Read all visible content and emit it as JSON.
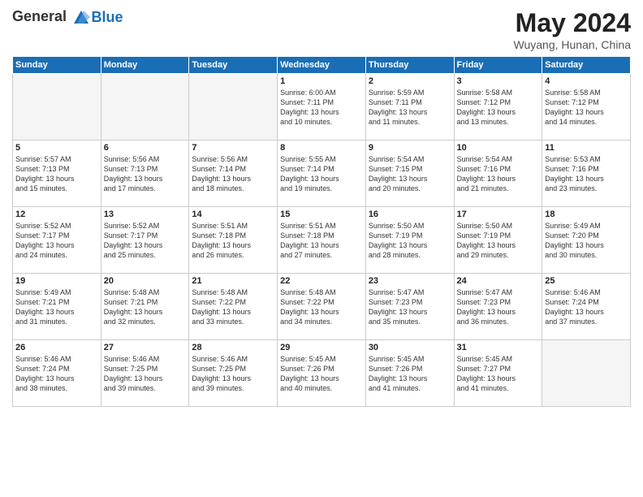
{
  "header": {
    "logo_general": "General",
    "logo_blue": "Blue",
    "month_year": "May 2024",
    "location": "Wuyang, Hunan, China"
  },
  "days_of_week": [
    "Sunday",
    "Monday",
    "Tuesday",
    "Wednesday",
    "Thursday",
    "Friday",
    "Saturday"
  ],
  "weeks": [
    [
      {
        "day": "",
        "info": ""
      },
      {
        "day": "",
        "info": ""
      },
      {
        "day": "",
        "info": ""
      },
      {
        "day": "1",
        "info": "Sunrise: 6:00 AM\nSunset: 7:11 PM\nDaylight: 13 hours\nand 10 minutes."
      },
      {
        "day": "2",
        "info": "Sunrise: 5:59 AM\nSunset: 7:11 PM\nDaylight: 13 hours\nand 11 minutes."
      },
      {
        "day": "3",
        "info": "Sunrise: 5:58 AM\nSunset: 7:12 PM\nDaylight: 13 hours\nand 13 minutes."
      },
      {
        "day": "4",
        "info": "Sunrise: 5:58 AM\nSunset: 7:12 PM\nDaylight: 13 hours\nand 14 minutes."
      }
    ],
    [
      {
        "day": "5",
        "info": "Sunrise: 5:57 AM\nSunset: 7:13 PM\nDaylight: 13 hours\nand 15 minutes."
      },
      {
        "day": "6",
        "info": "Sunrise: 5:56 AM\nSunset: 7:13 PM\nDaylight: 13 hours\nand 17 minutes."
      },
      {
        "day": "7",
        "info": "Sunrise: 5:56 AM\nSunset: 7:14 PM\nDaylight: 13 hours\nand 18 minutes."
      },
      {
        "day": "8",
        "info": "Sunrise: 5:55 AM\nSunset: 7:14 PM\nDaylight: 13 hours\nand 19 minutes."
      },
      {
        "day": "9",
        "info": "Sunrise: 5:54 AM\nSunset: 7:15 PM\nDaylight: 13 hours\nand 20 minutes."
      },
      {
        "day": "10",
        "info": "Sunrise: 5:54 AM\nSunset: 7:16 PM\nDaylight: 13 hours\nand 21 minutes."
      },
      {
        "day": "11",
        "info": "Sunrise: 5:53 AM\nSunset: 7:16 PM\nDaylight: 13 hours\nand 23 minutes."
      }
    ],
    [
      {
        "day": "12",
        "info": "Sunrise: 5:52 AM\nSunset: 7:17 PM\nDaylight: 13 hours\nand 24 minutes."
      },
      {
        "day": "13",
        "info": "Sunrise: 5:52 AM\nSunset: 7:17 PM\nDaylight: 13 hours\nand 25 minutes."
      },
      {
        "day": "14",
        "info": "Sunrise: 5:51 AM\nSunset: 7:18 PM\nDaylight: 13 hours\nand 26 minutes."
      },
      {
        "day": "15",
        "info": "Sunrise: 5:51 AM\nSunset: 7:18 PM\nDaylight: 13 hours\nand 27 minutes."
      },
      {
        "day": "16",
        "info": "Sunrise: 5:50 AM\nSunset: 7:19 PM\nDaylight: 13 hours\nand 28 minutes."
      },
      {
        "day": "17",
        "info": "Sunrise: 5:50 AM\nSunset: 7:19 PM\nDaylight: 13 hours\nand 29 minutes."
      },
      {
        "day": "18",
        "info": "Sunrise: 5:49 AM\nSunset: 7:20 PM\nDaylight: 13 hours\nand 30 minutes."
      }
    ],
    [
      {
        "day": "19",
        "info": "Sunrise: 5:49 AM\nSunset: 7:21 PM\nDaylight: 13 hours\nand 31 minutes."
      },
      {
        "day": "20",
        "info": "Sunrise: 5:48 AM\nSunset: 7:21 PM\nDaylight: 13 hours\nand 32 minutes."
      },
      {
        "day": "21",
        "info": "Sunrise: 5:48 AM\nSunset: 7:22 PM\nDaylight: 13 hours\nand 33 minutes."
      },
      {
        "day": "22",
        "info": "Sunrise: 5:48 AM\nSunset: 7:22 PM\nDaylight: 13 hours\nand 34 minutes."
      },
      {
        "day": "23",
        "info": "Sunrise: 5:47 AM\nSunset: 7:23 PM\nDaylight: 13 hours\nand 35 minutes."
      },
      {
        "day": "24",
        "info": "Sunrise: 5:47 AM\nSunset: 7:23 PM\nDaylight: 13 hours\nand 36 minutes."
      },
      {
        "day": "25",
        "info": "Sunrise: 5:46 AM\nSunset: 7:24 PM\nDaylight: 13 hours\nand 37 minutes."
      }
    ],
    [
      {
        "day": "26",
        "info": "Sunrise: 5:46 AM\nSunset: 7:24 PM\nDaylight: 13 hours\nand 38 minutes."
      },
      {
        "day": "27",
        "info": "Sunrise: 5:46 AM\nSunset: 7:25 PM\nDaylight: 13 hours\nand 39 minutes."
      },
      {
        "day": "28",
        "info": "Sunrise: 5:46 AM\nSunset: 7:25 PM\nDaylight: 13 hours\nand 39 minutes."
      },
      {
        "day": "29",
        "info": "Sunrise: 5:45 AM\nSunset: 7:26 PM\nDaylight: 13 hours\nand 40 minutes."
      },
      {
        "day": "30",
        "info": "Sunrise: 5:45 AM\nSunset: 7:26 PM\nDaylight: 13 hours\nand 41 minutes."
      },
      {
        "day": "31",
        "info": "Sunrise: 5:45 AM\nSunset: 7:27 PM\nDaylight: 13 hours\nand 41 minutes."
      },
      {
        "day": "",
        "info": ""
      }
    ]
  ]
}
